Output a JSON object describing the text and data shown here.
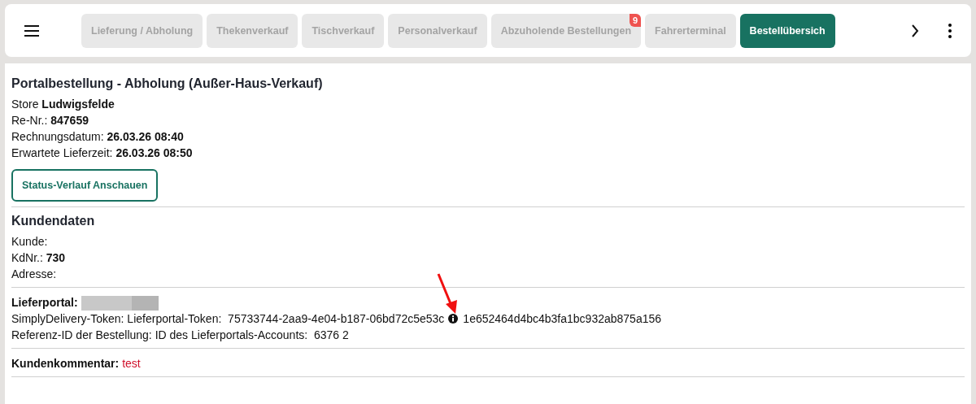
{
  "tabs": [
    {
      "label": "Lieferung / Abholung",
      "selected": false
    },
    {
      "label": "Thekenverkauf",
      "selected": false
    },
    {
      "label": "Tischverkauf",
      "selected": false
    },
    {
      "label": "Personalverkauf",
      "selected": false
    },
    {
      "label": "Abzuholende Bestellungen",
      "selected": false,
      "badge": "9"
    },
    {
      "label": "Fahrerterminal",
      "selected": false
    },
    {
      "label": "Bestellübersich",
      "selected": true
    }
  ],
  "order": {
    "title": "Portalbestellung - Abholung (Außer-Haus-Verkauf)",
    "fields": [
      {
        "label": "Store",
        "value": "Ludwigsfelde"
      },
      {
        "label": "Re-Nr.:",
        "value": "847659"
      },
      {
        "label": "Rechnungsdatum:",
        "value": "26.03.26 08:40"
      },
      {
        "label": "Erwartete Lieferzeit:",
        "value": "26.03.26 08:50"
      }
    ],
    "button": "Status-Verlauf Anschauen"
  },
  "customer": {
    "title": "Kundendaten",
    "fields": [
      {
        "label": "Kunde:"
      },
      {
        "label": "KdNr.:",
        "value": "730"
      },
      {
        "label": "Adresse:"
      }
    ]
  },
  "portal": {
    "label": "Lieferportal:",
    "token_label": "SimplyDelivery-Token: Lieferportal-Token:",
    "token": "75733744-2aa9-4e04-b187-06bd72c5e53c",
    "token_2": "1e652464d4bc4b3fa1bc932ab875a156",
    "reference_label": "Referenz-ID der Bestellung: ID des Lieferportals-Accounts:",
    "reference": "6376 2"
  },
  "comment": {
    "label": "Kundenkommentar:",
    "value": "test"
  }
}
